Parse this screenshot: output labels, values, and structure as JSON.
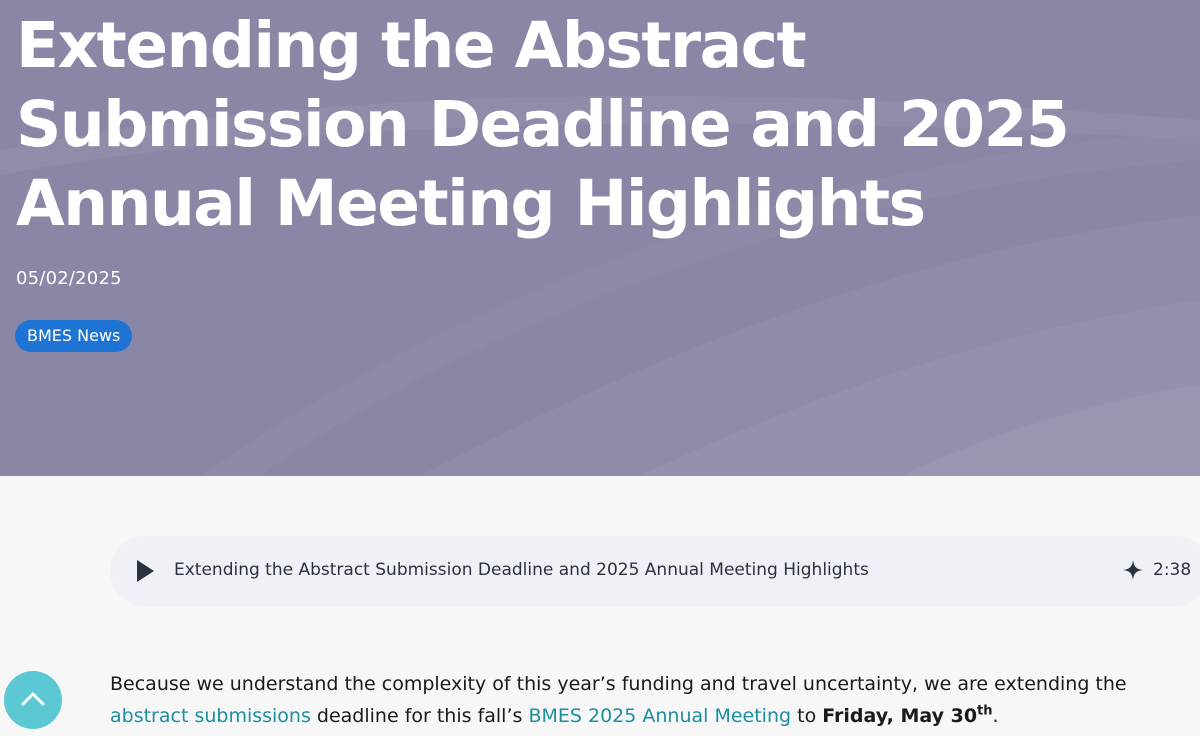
{
  "hero": {
    "title": "Extending the Abstract Submission Deadline and 2025 Annual Meeting Highlights",
    "date": "05/02/2025",
    "tag": "BMES News",
    "colors": {
      "background": "#8a87a6",
      "tag": "#1f73d3"
    }
  },
  "player": {
    "play_icon": "play-icon",
    "title": "Extending the Abstract Submission Deadline and 2025 Annual Meeting Highlights",
    "sparkle_icon": "sparkle-icon",
    "duration": "2:38"
  },
  "body": {
    "p1_before": "Because we understand the complexity of this year’s funding and travel uncertainty, we are extending the ",
    "p1_link1": "abstract submissions",
    "p1_mid": " deadline for this fall’s ",
    "p1_link2": "BMES 2025 Annual Meeting",
    "p1_to": " to ",
    "p1_bold": "Friday, May 30",
    "p1_sup": "th",
    "p1_end": ".",
    "link_color": "#1a8fa0"
  },
  "scroll_top": {
    "icon": "chevron-up-icon",
    "color": "#5bc8d3"
  }
}
